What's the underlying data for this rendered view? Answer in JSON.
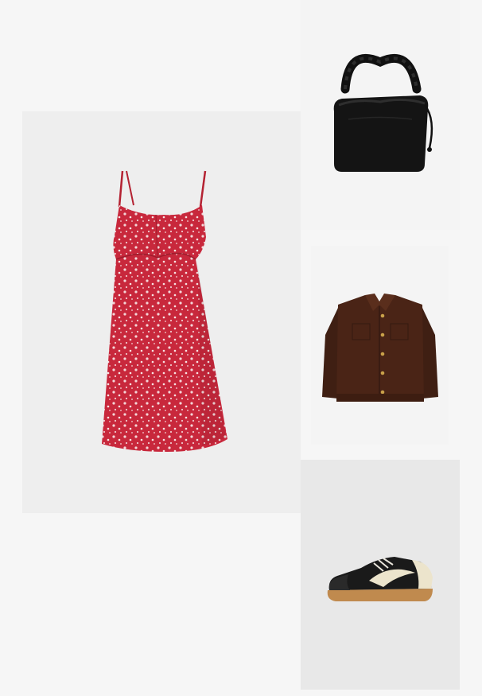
{
  "outfit": {
    "items": [
      {
        "id": "dress",
        "icon": "floral-slip-dress",
        "color": "#c8283c"
      },
      {
        "id": "bag",
        "icon": "ruched-handle-bag",
        "color": "#141414"
      },
      {
        "id": "jacket",
        "icon": "corduroy-jacket",
        "color": "#4a2416"
      },
      {
        "id": "sneaker",
        "icon": "retro-sneaker",
        "color": "#1a1a1a"
      }
    ]
  }
}
